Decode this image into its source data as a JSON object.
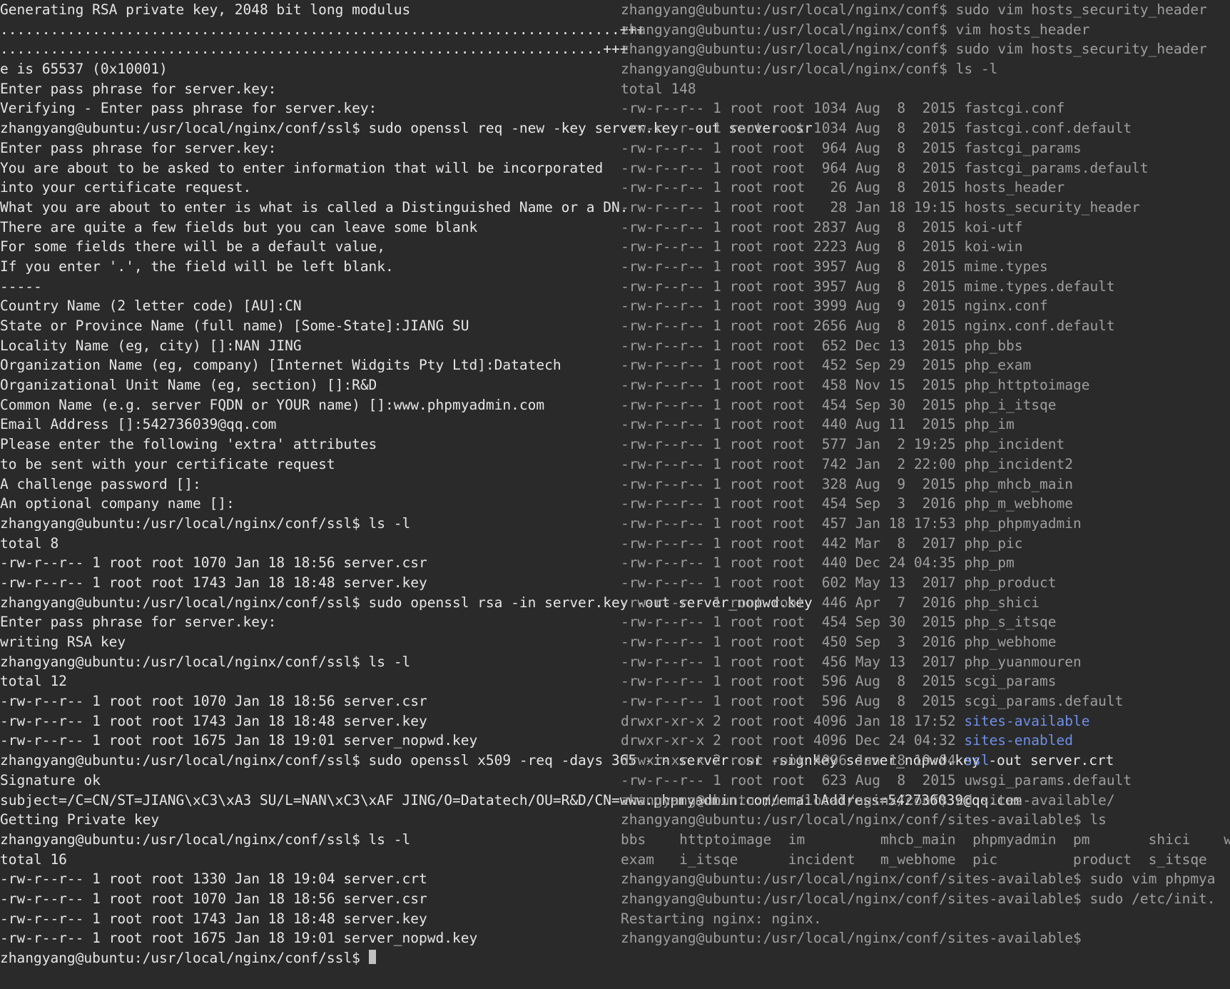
{
  "left": {
    "lines": [
      "Generating RSA private key, 2048 bit long modulus",
      "..........................................................................+++",
      "........................................................................+++",
      "e is 65537 (0x10001)",
      "Enter pass phrase for server.key:",
      "Verifying - Enter pass phrase for server.key:",
      "zhangyang@ubuntu:/usr/local/nginx/conf/ssl$ sudo openssl req -new -key server.key -out server.csr",
      "Enter pass phrase for server.key:",
      "You are about to be asked to enter information that will be incorporated",
      "into your certificate request.",
      "What you are about to enter is what is called a Distinguished Name or a DN.",
      "There are quite a few fields but you can leave some blank",
      "For some fields there will be a default value,",
      "If you enter '.', the field will be left blank.",
      "-----",
      "Country Name (2 letter code) [AU]:CN",
      "State or Province Name (full name) [Some-State]:JIANG SU",
      "Locality Name (eg, city) []:NAN JING",
      "Organization Name (eg, company) [Internet Widgits Pty Ltd]:Datatech",
      "Organizational Unit Name (eg, section) []:R&D",
      "Common Name (e.g. server FQDN or YOUR name) []:www.phpmyadmin.com",
      "Email Address []:542736039@qq.com",
      "",
      "Please enter the following 'extra' attributes",
      "to be sent with your certificate request",
      "A challenge password []:",
      "An optional company name []:",
      "zhangyang@ubuntu:/usr/local/nginx/conf/ssl$ ls -l",
      "total 8",
      "-rw-r--r-- 1 root root 1070 Jan 18 18:56 server.csr",
      "-rw-r--r-- 1 root root 1743 Jan 18 18:48 server.key",
      "zhangyang@ubuntu:/usr/local/nginx/conf/ssl$ sudo openssl rsa -in server.key -out server_nopwd.key",
      "Enter pass phrase for server.key:",
      "writing RSA key",
      "zhangyang@ubuntu:/usr/local/nginx/conf/ssl$ ls -l",
      "total 12",
      "-rw-r--r-- 1 root root 1070 Jan 18 18:56 server.csr",
      "-rw-r--r-- 1 root root 1743 Jan 18 18:48 server.key",
      "-rw-r--r-- 1 root root 1675 Jan 18 19:01 server_nopwd.key",
      "zhangyang@ubuntu:/usr/local/nginx/conf/ssl$ sudo openssl x509 -req -days 365 -in server.csr -signkey server_nopwd.key -out server.crt",
      "Signature ok",
      "subject=/C=CN/ST=JIANG\\xC3\\xA3 SU/L=NAN\\xC3\\xAF JING/O=Datatech/OU=R&D/CN=www.phpmyadmin.com/emailAddress=542736039@qq.com",
      "Getting Private key",
      "zhangyang@ubuntu:/usr/local/nginx/conf/ssl$ ls -l",
      "total 16",
      "-rw-r--r-- 1 root root 1330 Jan 18 19:04 server.crt",
      "-rw-r--r-- 1 root root 1070 Jan 18 18:56 server.csr",
      "-rw-r--r-- 1 root root 1743 Jan 18 18:48 server.key",
      "-rw-r--r-- 1 root root 1675 Jan 18 19:01 server_nopwd.key",
      "zhangyang@ubuntu:/usr/local/nginx/conf/ssl$ "
    ]
  },
  "right": {
    "lines": [
      "zhangyang@ubuntu:/usr/local/nginx/conf$ sudo vim hosts_security_header",
      "zhangyang@ubuntu:/usr/local/nginx/conf$ vim hosts_header",
      "zhangyang@ubuntu:/usr/local/nginx/conf$ sudo vim hosts_security_header",
      "zhangyang@ubuntu:/usr/local/nginx/conf$ ls -l",
      "total 148",
      "-rw-r--r-- 1 root root 1034 Aug  8  2015 fastcgi.conf",
      "-rw-r--r-- 1 root root 1034 Aug  8  2015 fastcgi.conf.default",
      "-rw-r--r-- 1 root root  964 Aug  8  2015 fastcgi_params",
      "-rw-r--r-- 1 root root  964 Aug  8  2015 fastcgi_params.default",
      "-rw-r--r-- 1 root root   26 Aug  8  2015 hosts_header",
      "-rw-r--r-- 1 root root   28 Jan 18 19:15 hosts_security_header",
      "-rw-r--r-- 1 root root 2837 Aug  8  2015 koi-utf",
      "-rw-r--r-- 1 root root 2223 Aug  8  2015 koi-win",
      "-rw-r--r-- 1 root root 3957 Aug  8  2015 mime.types",
      "-rw-r--r-- 1 root root 3957 Aug  8  2015 mime.types.default",
      "-rw-r--r-- 1 root root 3999 Aug  9  2015 nginx.conf",
      "-rw-r--r-- 1 root root 2656 Aug  8  2015 nginx.conf.default",
      "-rw-r--r-- 1 root root  652 Dec 13  2015 php_bbs",
      "-rw-r--r-- 1 root root  452 Sep 29  2015 php_exam",
      "-rw-r--r-- 1 root root  458 Nov 15  2015 php_httptoimage",
      "-rw-r--r-- 1 root root  454 Sep 30  2015 php_i_itsqe",
      "-rw-r--r-- 1 root root  440 Aug 11  2015 php_im",
      "-rw-r--r-- 1 root root  577 Jan  2 19:25 php_incident",
      "-rw-r--r-- 1 root root  742 Jan  2 22:00 php_incident2",
      "-rw-r--r-- 1 root root  328 Aug  9  2015 php_mhcb_main",
      "-rw-r--r-- 1 root root  454 Sep  3  2016 php_m_webhome",
      "-rw-r--r-- 1 root root  457 Jan 18 17:53 php_phpmyadmin",
      "-rw-r--r-- 1 root root  442 Mar  8  2017 php_pic",
      "-rw-r--r-- 1 root root  440 Dec 24 04:35 php_pm",
      "-rw-r--r-- 1 root root  602 May 13  2017 php_product",
      "-rw-r--r-- 1 root root  446 Apr  7  2016 php_shici",
      "-rw-r--r-- 1 root root  454 Sep 30  2015 php_s_itsqe",
      "-rw-r--r-- 1 root root  450 Sep  3  2016 php_webhome",
      "-rw-r--r-- 1 root root  456 May 13  2017 php_yuanmouren",
      "-rw-r--r-- 1 root root  596 Aug  8  2015 scgi_params",
      "-rw-r--r-- 1 root root  596 Aug  8  2015 scgi_params.default"
    ],
    "dirs": [
      "drwxr-xr-x 2 root root 4096 Jan 18 17:52 ",
      "drwxr-xr-x 2 root root 4096 Dec 24 04:32 ",
      "drwxr-xr-x 2 root root 4096 Jan 18 19:04 "
    ],
    "dir_names": [
      "sites-available",
      "sites-enabled",
      "ssl"
    ],
    "after": [
      "-rw-r--r-- 1 root root  623 Aug  8  2015 uwsgi_params.default",
      "zhangyang@ubuntu:/usr/local/nginx/conf$ cd sites-available/",
      "zhangyang@ubuntu:/usr/local/nginx/conf/sites-available$ ls",
      "bbs    httptoimage  im         mhcb_main  phpmyadmin  pm       shici    w",
      "exam   i_itsqe      incident   m_webhome  pic         product  s_itsqe",
      "zhangyang@ubuntu:/usr/local/nginx/conf/sites-available$ sudo vim phpmya",
      "zhangyang@ubuntu:/usr/local/nginx/conf/sites-available$ sudo /etc/init.",
      "Restarting nginx: nginx.",
      "zhangyang@ubuntu:/usr/local/nginx/conf/sites-available$"
    ]
  }
}
